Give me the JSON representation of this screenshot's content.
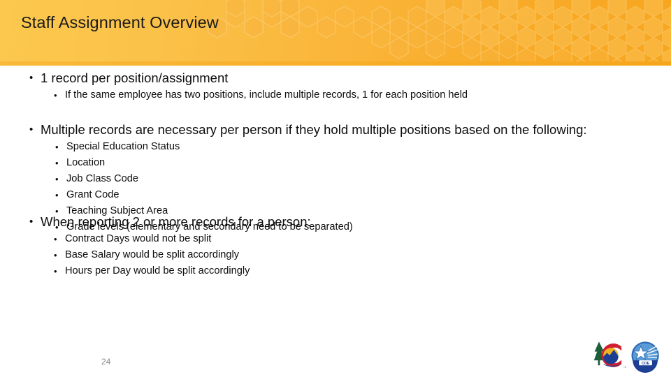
{
  "slide": {
    "title": "Staff Assignment Overview",
    "number": "24",
    "theme": {
      "header_gradient_left": "#fcc84e",
      "header_gradient_right": "#f7a61e",
      "header_rule": "#f7ac26",
      "text_color": "#0d0d0d",
      "slide_number_color": "#8a8a8a"
    }
  },
  "blocks": [
    {
      "bullet": "1 record per position/assignment",
      "sub": [
        "If the same employee has two positions, include multiple records, 1 for each position held"
      ]
    },
    {
      "bullet": "Multiple records are necessary per person if they hold multiple positions based on the following:",
      "sub": [
        "Special Education Status",
        "Location",
        "Job Class Code",
        "Grant Code",
        "Teaching Subject Area",
        "Grade levels (elementary and secondary need to be separated)"
      ]
    },
    {
      "bullet": "When reporting 2 or more records for a person:",
      "sub": [
        "Contract Days would not be split",
        "Base Salary would be split accordingly",
        "Hours per Day would be split accordingly"
      ]
    }
  ],
  "bullet_glyph": "•",
  "logos": {
    "colorado": {
      "name": "colorado-state-logo",
      "colors": {
        "tree": "#1b5e38",
        "c_ring": "#cf2030",
        "sun": "#f0b323",
        "mountain": "#1c3f94"
      }
    },
    "cde": {
      "name": "cde-logo",
      "label": "CDE",
      "colors": {
        "circle": "#2b6cb8",
        "disc": "#5b9bd5",
        "star": "#ffffff",
        "base": "#1c3f94"
      }
    }
  }
}
